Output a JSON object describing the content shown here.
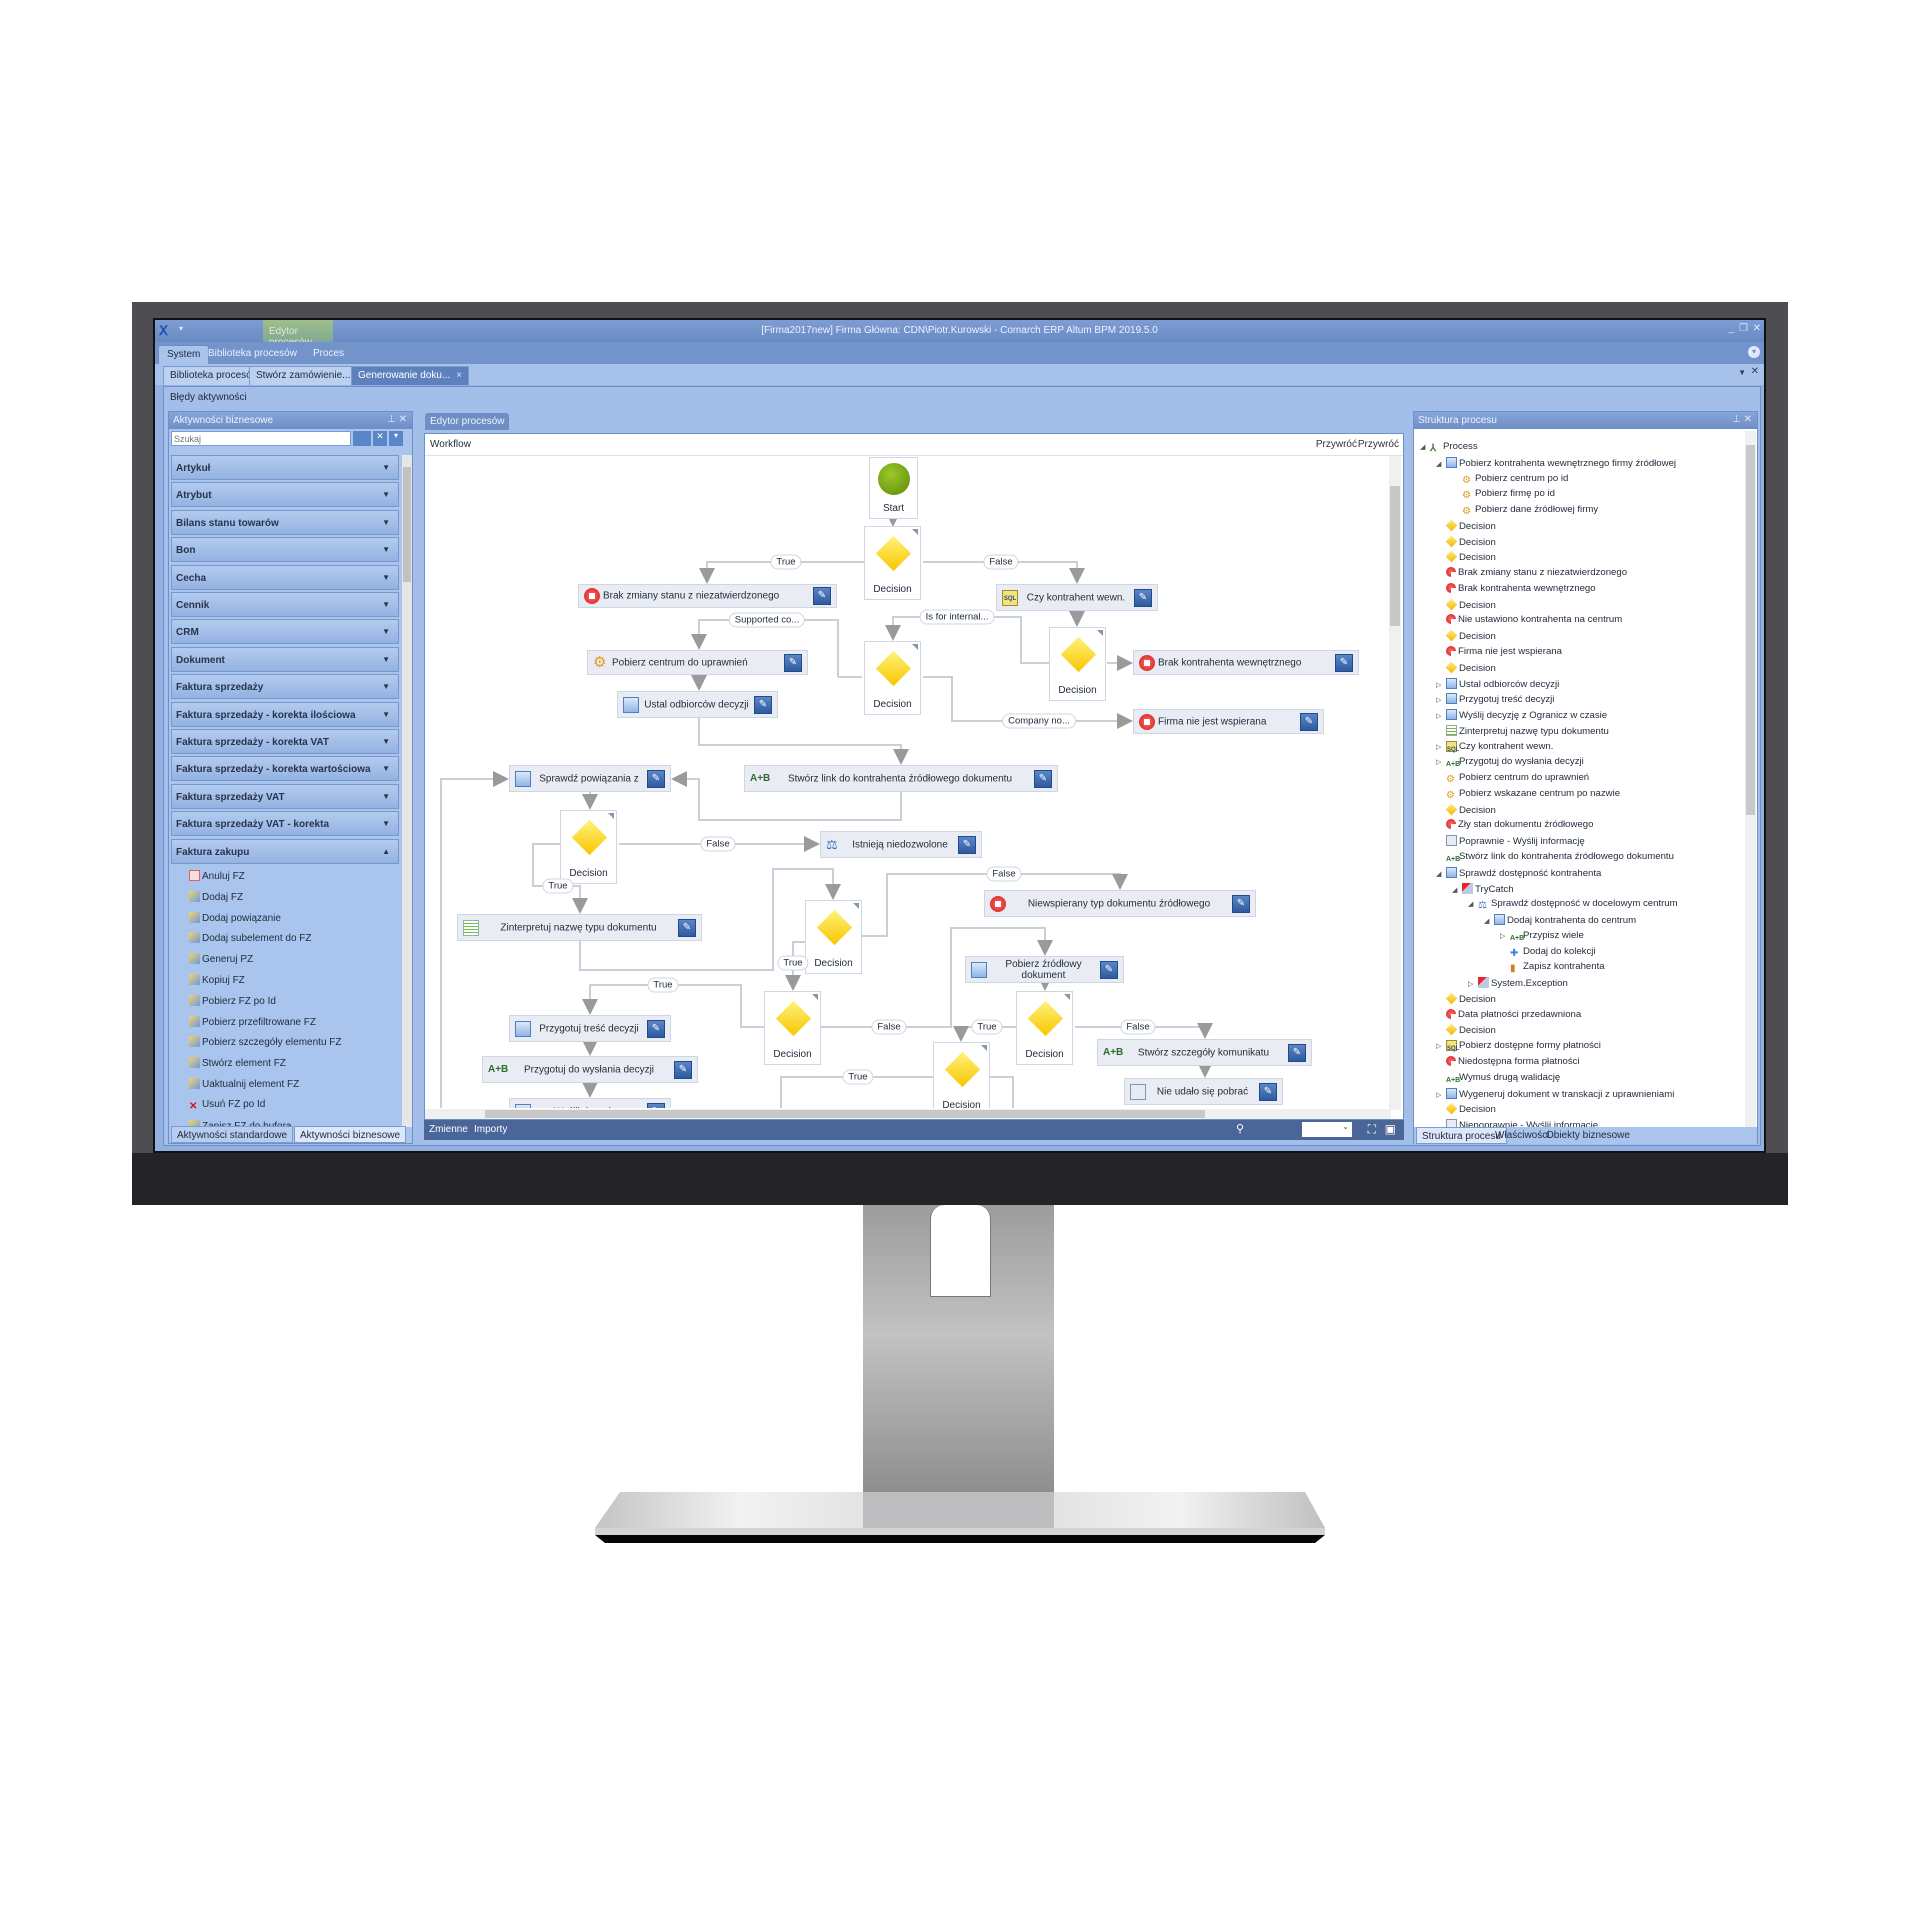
{
  "window": {
    "title": "[Firma2017new] Firma Główna: CDN\\Piotr.Kurowski - Comarch ERP Altum BPM 2019.5.0",
    "controls": [
      "_",
      "❐",
      "✕"
    ]
  },
  "ribbon": {
    "contextual_group": "Edytor procesów",
    "tabs": [
      "System",
      "Biblioteka procesów",
      "Proces"
    ]
  },
  "doc_tabs": [
    {
      "label": "Biblioteka procesów"
    },
    {
      "label": "Stwórz zamówienie...",
      "close": "×"
    },
    {
      "label": "Generowanie doku...",
      "close": "×",
      "active": true
    }
  ],
  "errors_bar": {
    "label": "Błędy aktywności"
  },
  "left_panel": {
    "title": "Aktywności biznesowe",
    "search_placeholder": "Szukaj",
    "categories": [
      "Artykuł",
      "Atrybut",
      "Bilans stanu towarów",
      "Bon",
      "Cecha",
      "Cennik",
      "CRM",
      "Dokument",
      "Faktura sprzedaży",
      "Faktura sprzedaży - korekta ilościowa",
      "Faktura sprzedaży - korekta VAT",
      "Faktura sprzedaży - korekta wartościowa",
      "Faktura sprzedaży VAT",
      "Faktura sprzedaży VAT - korekta",
      "Faktura zakupu"
    ],
    "expanded_category": "Faktura zakupu",
    "items": [
      {
        "label": "Anuluj FZ",
        "icon": "cancel-doc-icon"
      },
      {
        "label": "Dodaj FZ",
        "icon": "add-doc-icon"
      },
      {
        "label": "Dodaj powiązanie",
        "icon": "link-icon"
      },
      {
        "label": "Dodaj subelement do FZ",
        "icon": "add-subelement-icon"
      },
      {
        "label": "Generuj PZ",
        "icon": "generate-icon"
      },
      {
        "label": "Kopiuj FZ",
        "icon": "copy-icon"
      },
      {
        "label": "Pobierz FZ po Id",
        "icon": "get-icon"
      },
      {
        "label": "Pobierz przefiltrowane FZ",
        "icon": "filter-icon"
      },
      {
        "label": "Pobierz szczegóły elementu FZ",
        "icon": "details-icon"
      },
      {
        "label": "Stwórz element FZ",
        "icon": "create-icon"
      },
      {
        "label": "Uaktualnij element FZ",
        "icon": "update-icon"
      },
      {
        "label": "Usuń FZ po Id",
        "icon": "delete-icon"
      },
      {
        "label": "Zapisz FZ do bufora",
        "icon": "save-icon"
      }
    ],
    "bottom_tabs": [
      "Aktywności standardowe",
      "Aktywności biznesowe"
    ]
  },
  "editor": {
    "tab": "Edytor procesów",
    "breadcrumb": "Workflow",
    "actions": [
      "Przywróć",
      "Przywróć"
    ],
    "nodes": [
      {
        "label": "Start",
        "type": "start"
      },
      {
        "label": "Decision",
        "type": "decision"
      },
      {
        "label": "Brak zmiany stanu z niezatwierdzonego",
        "type": "activity",
        "icon": "stop"
      },
      {
        "label": "Czy kontrahent wewn.",
        "type": "activity",
        "icon": "sql"
      },
      {
        "label": "Pobierz centrum do uprawnień",
        "type": "activity",
        "icon": "gear"
      },
      {
        "label": "Decision",
        "type": "decision"
      },
      {
        "label": "Decision",
        "type": "decision"
      },
      {
        "label": "Brak kontrahenta wewnętrznego",
        "type": "activity",
        "icon": "stop"
      },
      {
        "label": "Ustal odbiorców decyzji",
        "type": "activity",
        "icon": "seq"
      },
      {
        "label": "Firma nie jest wspierana",
        "type": "activity",
        "icon": "stop"
      },
      {
        "label": "Sprawdź powiązania z",
        "type": "activity",
        "icon": "seq"
      },
      {
        "label": "Stwórz link do kontrahenta źródłowego dokumentu",
        "type": "activity",
        "icon": "ab"
      },
      {
        "label": "Decision",
        "type": "decision"
      },
      {
        "label": "Istnieją niedozwolone",
        "type": "activity",
        "icon": "flow"
      },
      {
        "label": "Zinterpretuj nazwę typu dokumentu",
        "type": "activity",
        "icon": "list"
      },
      {
        "label": "Niewspierany typ dokumentu źródłowego",
        "type": "activity",
        "icon": "stop"
      },
      {
        "label": "Decision",
        "type": "decision"
      },
      {
        "label": "Pobierz źródłowy dokument",
        "type": "activity",
        "icon": "seq"
      },
      {
        "label": "Przygotuj treść decyzji",
        "type": "activity",
        "icon": "seq"
      },
      {
        "label": "Decision",
        "type": "decision"
      },
      {
        "label": "Decision",
        "type": "decision"
      },
      {
        "label": "Stwórz szczegóły komunikatu",
        "type": "activity",
        "icon": "ab"
      },
      {
        "label": "Przygotuj do wysłania decyzji",
        "type": "activity",
        "icon": "ab"
      },
      {
        "label": "Decision",
        "type": "decision"
      },
      {
        "label": "Nie udało się pobrać",
        "type": "activity",
        "icon": "mail"
      },
      {
        "label": "Wyślij decyzję z",
        "type": "activity",
        "icon": "seq"
      }
    ],
    "edge_labels": [
      "True",
      "False",
      "Supported co...",
      "Is for internal...",
      "Company no...",
      "False",
      "True",
      "False",
      "True",
      "True",
      "False",
      "True",
      "False",
      "True"
    ],
    "bottom_tabs": [
      "Zmienne",
      "Importy"
    ],
    "zoom_value": ""
  },
  "structure_panel": {
    "title": "Struktura procesu",
    "tree": [
      {
        "label": "Process",
        "level": 0,
        "exp": "open",
        "icon": "process"
      },
      {
        "label": "Pobierz kontrahenta wewnętrznego firmy źródłowej",
        "level": 1,
        "exp": "open",
        "icon": "seq"
      },
      {
        "label": "Pobierz centrum po id",
        "level": 2,
        "icon": "gear"
      },
      {
        "label": "Pobierz firmę po id",
        "level": 2,
        "icon": "gear"
      },
      {
        "label": "Pobierz dane źródłowej firmy",
        "level": 2,
        "icon": "gear"
      },
      {
        "label": "Decision",
        "level": 1,
        "icon": "decision"
      },
      {
        "label": "Decision",
        "level": 1,
        "icon": "decision"
      },
      {
        "label": "Decision",
        "level": 1,
        "icon": "decision"
      },
      {
        "label": "Brak zmiany stanu z niezatwierdzonego",
        "level": 1,
        "icon": "stop"
      },
      {
        "label": "Brak kontrahenta wewnętrznego",
        "level": 1,
        "icon": "stop"
      },
      {
        "label": "Decision",
        "level": 1,
        "icon": "decision"
      },
      {
        "label": "Nie ustawiono kontrahenta na centrum",
        "level": 1,
        "icon": "stop"
      },
      {
        "label": "Decision",
        "level": 1,
        "icon": "decision"
      },
      {
        "label": "Firma nie jest wspierana",
        "level": 1,
        "icon": "stop"
      },
      {
        "label": "Decision",
        "level": 1,
        "icon": "decision"
      },
      {
        "label": "Ustal odbiorców decyzji",
        "level": 1,
        "exp": "closed",
        "icon": "seq"
      },
      {
        "label": "Przygotuj treść decyzji",
        "level": 1,
        "exp": "closed",
        "icon": "seq"
      },
      {
        "label": "Wyślij decyzję z Ogranicz w czasie",
        "level": 1,
        "exp": "closed",
        "icon": "seq"
      },
      {
        "label": "Zinterpretuj nazwę typu dokumentu",
        "level": 1,
        "icon": "list"
      },
      {
        "label": "Czy kontrahent wewn.",
        "level": 1,
        "exp": "closed",
        "icon": "sql"
      },
      {
        "label": "Przygotuj do wysłania decyzji",
        "level": 1,
        "exp": "closed",
        "icon": "ab"
      },
      {
        "label": "Pobierz centrum do uprawnień",
        "level": 1,
        "icon": "gear"
      },
      {
        "label": "Pobierz wskazane centrum po nazwie",
        "level": 1,
        "icon": "gear"
      },
      {
        "label": "Decision",
        "level": 1,
        "icon": "decision"
      },
      {
        "label": "Zły stan dokumentu źródłowego",
        "level": 1,
        "icon": "stop"
      },
      {
        "label": "Poprawnie - Wyślij informację",
        "level": 1,
        "icon": "mail"
      },
      {
        "label": "Stwórz link do kontrahenta źródłowego dokumentu",
        "level": 1,
        "icon": "ab"
      },
      {
        "label": "Sprawdź dostępność kontrahenta",
        "level": 1,
        "exp": "open",
        "icon": "seq"
      },
      {
        "label": "TryCatch",
        "level": 2,
        "exp": "open",
        "icon": "trycatch"
      },
      {
        "label": "Sprawdź dostępność w docelowym centrum",
        "level": 3,
        "exp": "open",
        "icon": "flow"
      },
      {
        "label": "Dodaj kontrahenta do centrum",
        "level": 4,
        "exp": "open",
        "icon": "seq"
      },
      {
        "label": "Przypisz wiele",
        "level": 5,
        "exp": "closed",
        "icon": "ab"
      },
      {
        "label": "Dodaj do kolekcji",
        "level": 5,
        "icon": "add"
      },
      {
        "label": "Zapisz kontrahenta",
        "level": 5,
        "icon": "save"
      },
      {
        "label": "System.Exception",
        "level": 3,
        "exp": "closed",
        "icon": "trycatch"
      },
      {
        "label": "Decision",
        "level": 1,
        "icon": "decision"
      },
      {
        "label": "Data płatności przedawniona",
        "level": 1,
        "icon": "stop"
      },
      {
        "label": "Decision",
        "level": 1,
        "icon": "decision"
      },
      {
        "label": "Pobierz dostępne formy płatności",
        "level": 1,
        "exp": "closed",
        "icon": "sql"
      },
      {
        "label": "Niedostępna forma płatności",
        "level": 1,
        "icon": "stop"
      },
      {
        "label": "Wymuś drugą walidację",
        "level": 1,
        "icon": "ab"
      },
      {
        "label": "Wygeneruj dokument w transkacji  z uprawnieniami",
        "level": 1,
        "exp": "closed",
        "icon": "seq"
      },
      {
        "label": "Decision",
        "level": 1,
        "icon": "decision"
      },
      {
        "label": "Niepoprawnie - Wyślij informację",
        "level": 1,
        "icon": "mail"
      }
    ],
    "bottom_tabs": [
      "Struktura procesu",
      "Właściwości",
      "Obiekty biznesowe"
    ]
  },
  "colors": {
    "accent": "#4a6598",
    "panel": "#a7c3ec",
    "decision": "#f7c600",
    "start": "#6a9a10",
    "stop": "#d21a1a"
  }
}
